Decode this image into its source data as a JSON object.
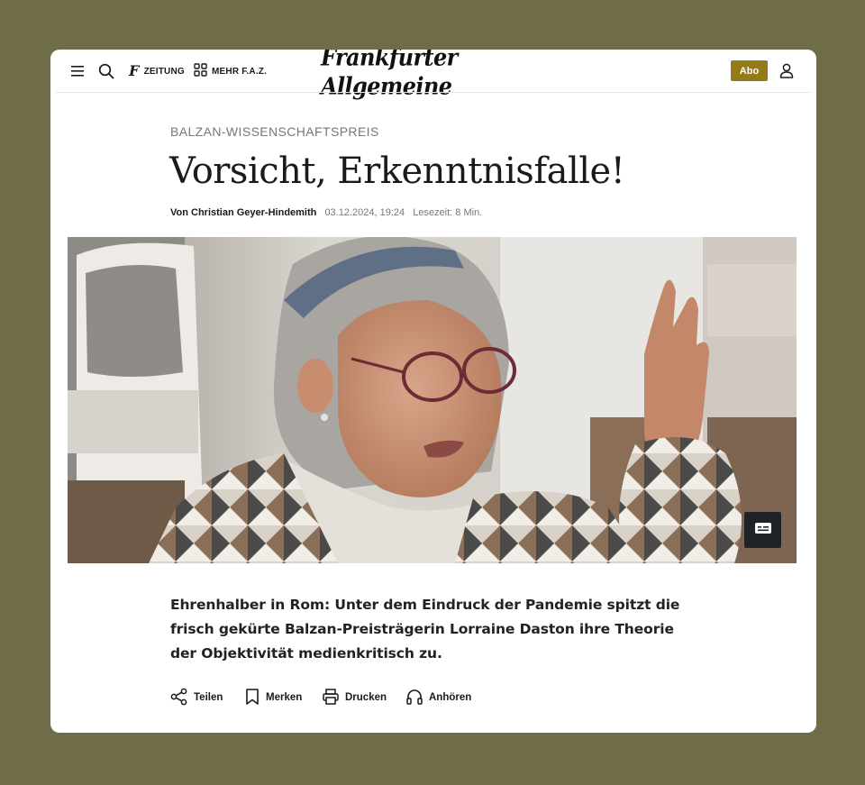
{
  "header": {
    "menu_icon": "menu-icon",
    "search_icon": "search-icon",
    "zeitung_label": "ZEITUNG",
    "mehr_label": "MEHR F.A.Z.",
    "logo_text": "Frankfurter Allgemeine",
    "abo_label": "Abo",
    "account_icon": "user-icon",
    "abo_color": "#937b17"
  },
  "article": {
    "kicker": "BALZAN-WISSENSCHAFTSPREIS",
    "title": "Vorsicht, Erkenntnisfalle!",
    "author": "Von Christian Geyer-Hindemith",
    "date": "03.12.2024, 19:24",
    "reading_time": "Lesezeit: 8 Min.",
    "lead": "Ehrenhalber in Rom: Unter dem Eindruck der Pandemie spitzt die frisch gekürte Balzan-Preisträgerin Lorraine Daston ihre Theorie der Objektivität medienkritisch zu.",
    "image_caption_icon": "subtitles-icon"
  },
  "actions": [
    {
      "label": "Teilen",
      "icon": "share-icon"
    },
    {
      "label": "Merken",
      "icon": "bookmark-icon"
    },
    {
      "label": "Drucken",
      "icon": "print-icon"
    },
    {
      "label": "Anhören",
      "icon": "headphones-icon"
    }
  ]
}
